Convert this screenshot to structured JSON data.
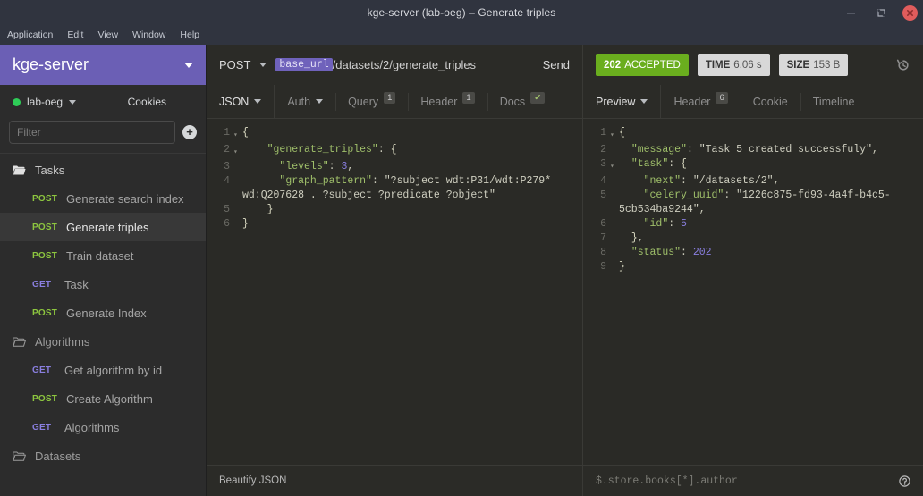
{
  "window": {
    "title": "kge-server (lab-oeg) – Generate triples",
    "controls": {
      "minimize": "–",
      "maximize": "❐",
      "close": "✕"
    }
  },
  "menubar": {
    "items": [
      "Application",
      "Edit",
      "View",
      "Window",
      "Help"
    ]
  },
  "sidebar": {
    "brand": "kge-server",
    "environment": {
      "name": "lab-oeg",
      "status_color": "#2ecc57"
    },
    "cookies_label": "Cookies",
    "filter": {
      "value": "",
      "placeholder": "Filter"
    },
    "add_button_label": "+",
    "groups": [
      {
        "name": "Tasks",
        "open": true,
        "items": [
          {
            "verb": "POST",
            "label": "Generate search index",
            "active": false
          },
          {
            "verb": "POST",
            "label": "Generate triples",
            "active": true
          },
          {
            "verb": "POST",
            "label": "Train dataset",
            "active": false
          },
          {
            "verb": "GET",
            "label": "Task",
            "active": false
          },
          {
            "verb": "POST",
            "label": "Generate Index",
            "active": false
          }
        ]
      },
      {
        "name": "Algorithms",
        "open": false,
        "items": [
          {
            "verb": "GET",
            "label": "Get algorithm by id",
            "active": false
          },
          {
            "verb": "POST",
            "label": "Create Algorithm",
            "active": false
          },
          {
            "verb": "GET",
            "label": "Algorithms",
            "active": false
          }
        ]
      },
      {
        "name": "Datasets",
        "open": false,
        "items": []
      }
    ]
  },
  "request": {
    "method": "POST",
    "url_variable": "base_url",
    "url_path": "/datasets/2/generate_triples",
    "send_label": "Send",
    "tabs": [
      {
        "label": "JSON",
        "primary": true,
        "caret": true,
        "badge": ""
      },
      {
        "label": "Auth",
        "primary": false,
        "caret": true,
        "badge": ""
      },
      {
        "label": "Query",
        "primary": false,
        "caret": false,
        "badge": "1"
      },
      {
        "label": "Header",
        "primary": false,
        "caret": false,
        "badge": "1"
      },
      {
        "label": "Docs",
        "primary": false,
        "caret": false,
        "badge": "✔"
      }
    ],
    "body_lines": [
      {
        "n": "1",
        "fold": true,
        "text": "{"
      },
      {
        "n": "2",
        "fold": true,
        "text": "    \"generate_triples\": {"
      },
      {
        "n": "3",
        "fold": false,
        "text": "      \"levels\": 3,"
      },
      {
        "n": "4",
        "fold": false,
        "text": "      \"graph_pattern\": \"?subject wdt:P31/wdt:P279* wd:Q207628 . ?subject ?predicate ?object\""
      },
      {
        "n": "5",
        "fold": false,
        "text": "    }"
      },
      {
        "n": "6",
        "fold": false,
        "text": "}"
      }
    ],
    "footer_action": "Beautify JSON"
  },
  "response": {
    "status": {
      "code": "202",
      "text": "ACCEPTED"
    },
    "time": {
      "label": "TIME",
      "value": "6.06 s"
    },
    "size": {
      "label": "SIZE",
      "value": "153 B"
    },
    "history_icon": "history-icon",
    "tabs": [
      {
        "label": "Preview",
        "primary": true,
        "caret": true,
        "badge": ""
      },
      {
        "label": "Header",
        "primary": false,
        "caret": false,
        "badge": "6"
      },
      {
        "label": "Cookie",
        "primary": false,
        "caret": false,
        "badge": ""
      },
      {
        "label": "Timeline",
        "primary": false,
        "caret": false,
        "badge": ""
      }
    ],
    "body_lines": [
      {
        "n": "1",
        "fold": true,
        "text": "{"
      },
      {
        "n": "2",
        "fold": false,
        "text": "  \"message\": \"Task 5 created successfuly\","
      },
      {
        "n": "3",
        "fold": true,
        "text": "  \"task\": {"
      },
      {
        "n": "4",
        "fold": false,
        "text": "    \"next\": \"/datasets/2\","
      },
      {
        "n": "5",
        "fold": false,
        "text": "    \"celery_uuid\": \"1226c875-fd93-4a4f-b4c5-5cb534ba9244\","
      },
      {
        "n": "6",
        "fold": false,
        "text": "    \"id\": 5"
      },
      {
        "n": "7",
        "fold": false,
        "text": "  },"
      },
      {
        "n": "8",
        "fold": false,
        "text": "  \"status\": 202"
      },
      {
        "n": "9",
        "fold": false,
        "text": "}"
      }
    ],
    "jsonpath_filter": {
      "value": "",
      "placeholder": "$.store.books[*].author"
    },
    "help_icon": "help-icon"
  },
  "colors": {
    "brand_purple": "#6b5fb5",
    "status_green": "#6aae1e",
    "verb_post": "#8dc63f",
    "verb_get": "#8a7fe0",
    "titlebar": "#30343f",
    "editor_bg": "#2a2a26"
  }
}
